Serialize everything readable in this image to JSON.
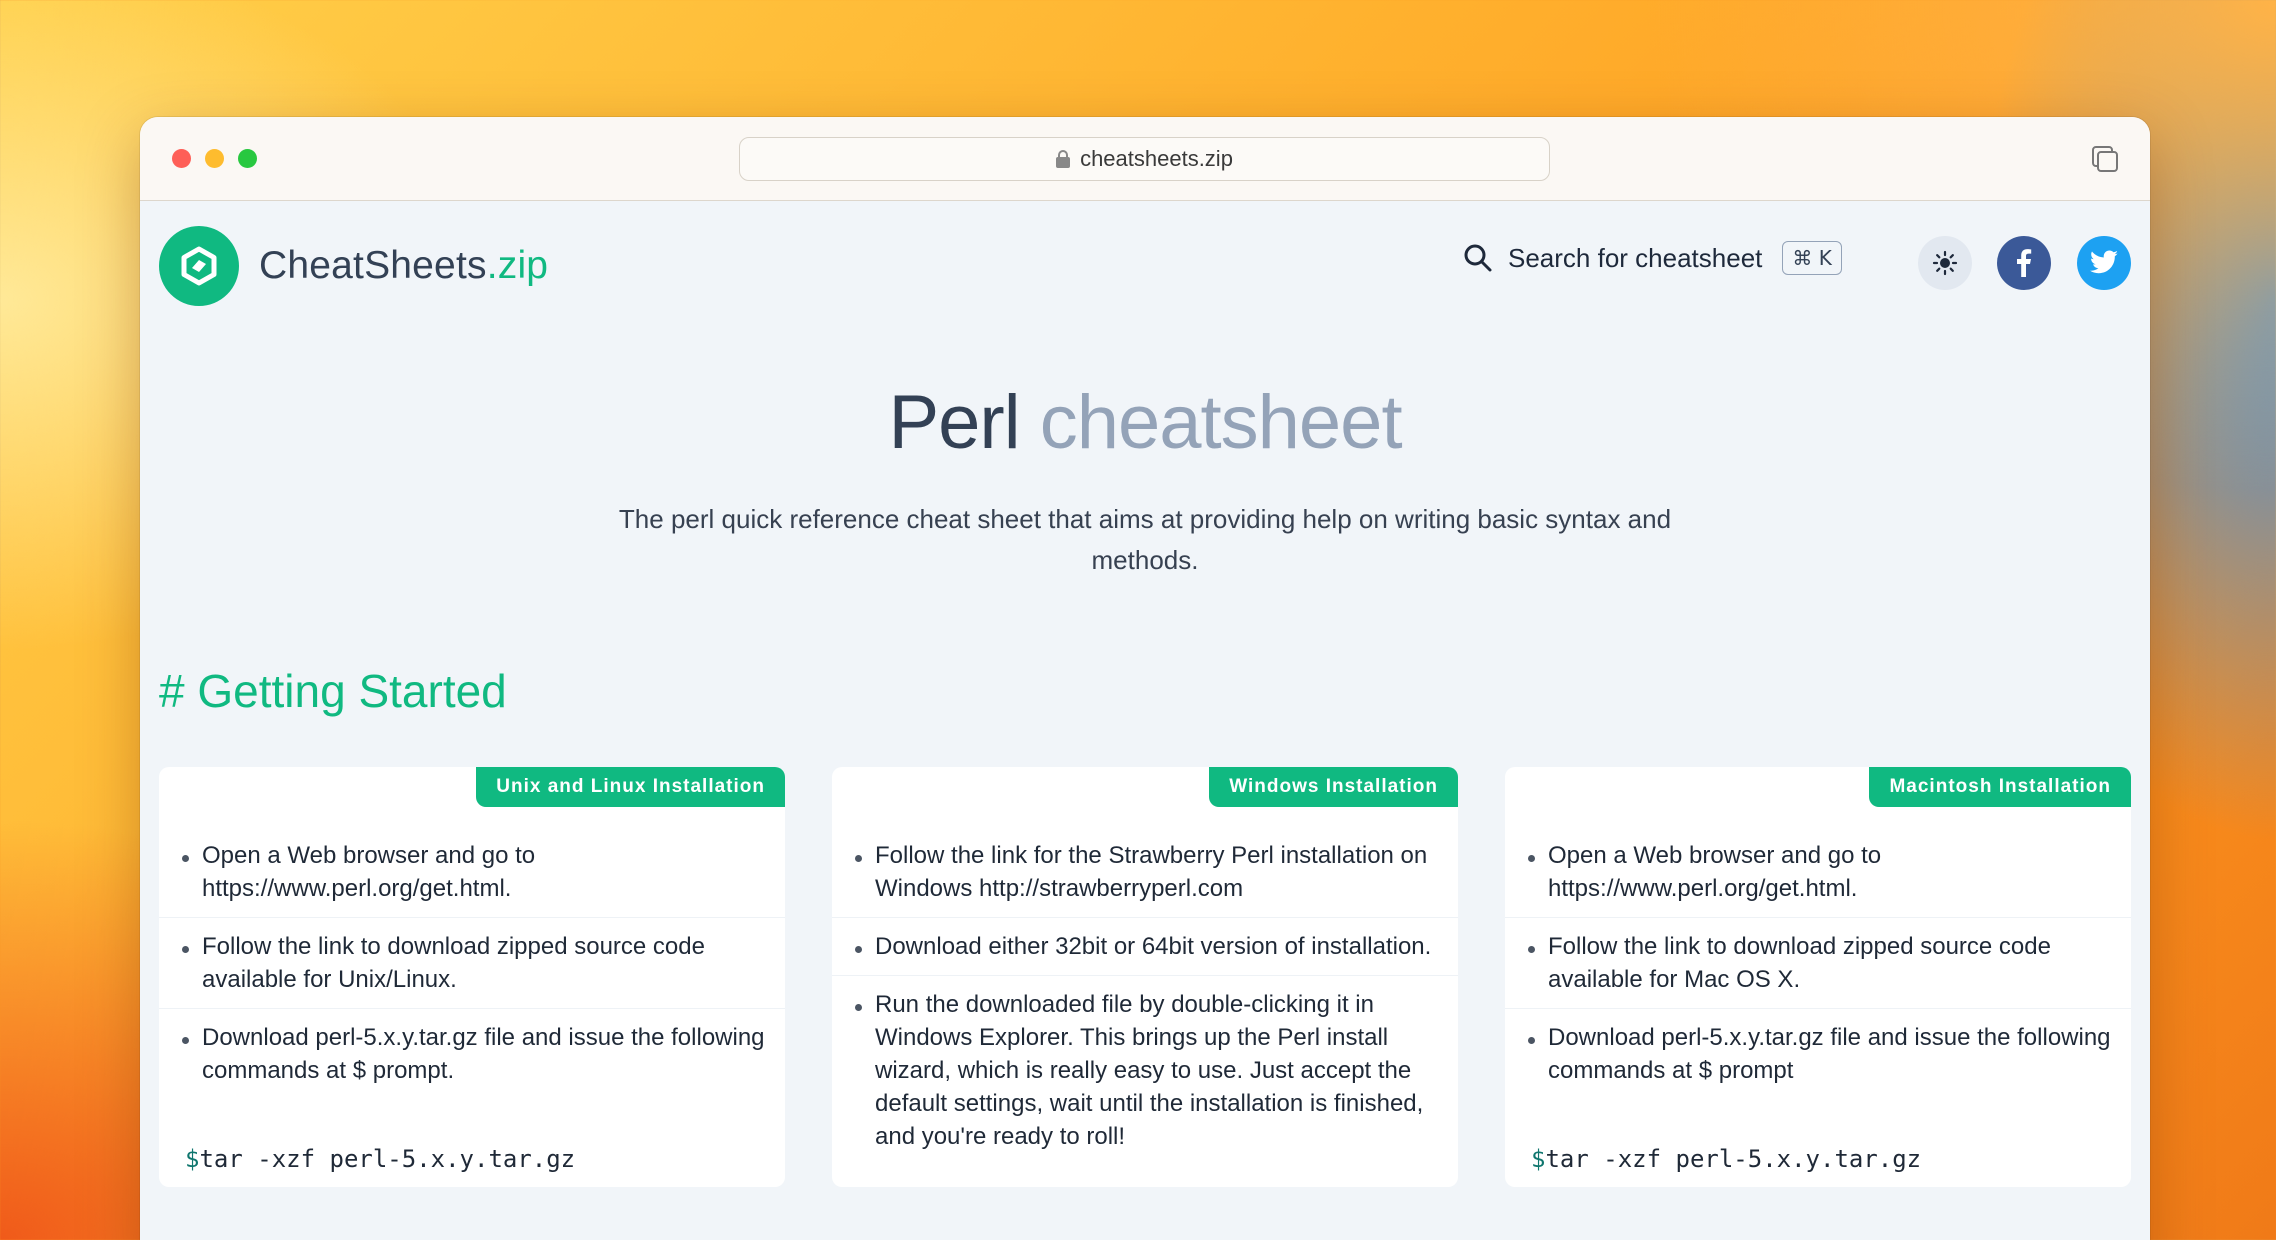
{
  "browser": {
    "url": "cheatsheets.zip"
  },
  "site": {
    "logo_name": "CheatSheets",
    "logo_suffix": ".zip",
    "search_label": "Search for cheatsheet",
    "search_shortcut": "⌘ K"
  },
  "hero": {
    "title_main": "Perl",
    "title_light": "cheatsheet",
    "description": "The perl quick reference cheat sheet that aims at providing help on writing basic syntax and methods."
  },
  "section": {
    "title": "# Getting Started"
  },
  "cards": [
    {
      "tag": "Unix and Linux Installation",
      "items": [
        "Open a Web browser and go to https://www.perl.org/get.html.",
        "Follow the link to download zipped source code available for Unix/Linux.",
        "Download perl-5.x.y.tar.gz file and issue the following commands at $ prompt."
      ],
      "code_prompt": "$",
      "code_text": "tar -xzf perl-5.x.y.tar.gz"
    },
    {
      "tag": "Windows Installation",
      "items": [
        "Follow the link for the Strawberry Perl installation on Windows http://strawberryperl.com",
        "Download either 32bit or 64bit version of installation.",
        "Run the downloaded file by double-clicking it in Windows Explorer. This brings up the Perl install wizard, which is really easy to use. Just accept the default settings, wait until the installation is finished, and you're ready to roll!"
      ]
    },
    {
      "tag": "Macintosh Installation",
      "items": [
        "Open a Web browser and go to https://www.perl.org/get.html.",
        "Follow the link to download zipped source code available for Mac OS X.",
        "Download perl-5.x.y.tar.gz file and issue the following commands at $ prompt"
      ],
      "code_prompt": "$",
      "code_text": "tar -xzf perl-5.x.y.tar.gz"
    }
  ],
  "colors": {
    "accent": "#10b981",
    "facebook": "#3b5998",
    "twitter": "#1da1f2"
  },
  "icons": [
    "lock-icon",
    "tabs-icon",
    "logo-icon",
    "search-icon",
    "sun-icon",
    "facebook-icon",
    "twitter-icon"
  ]
}
